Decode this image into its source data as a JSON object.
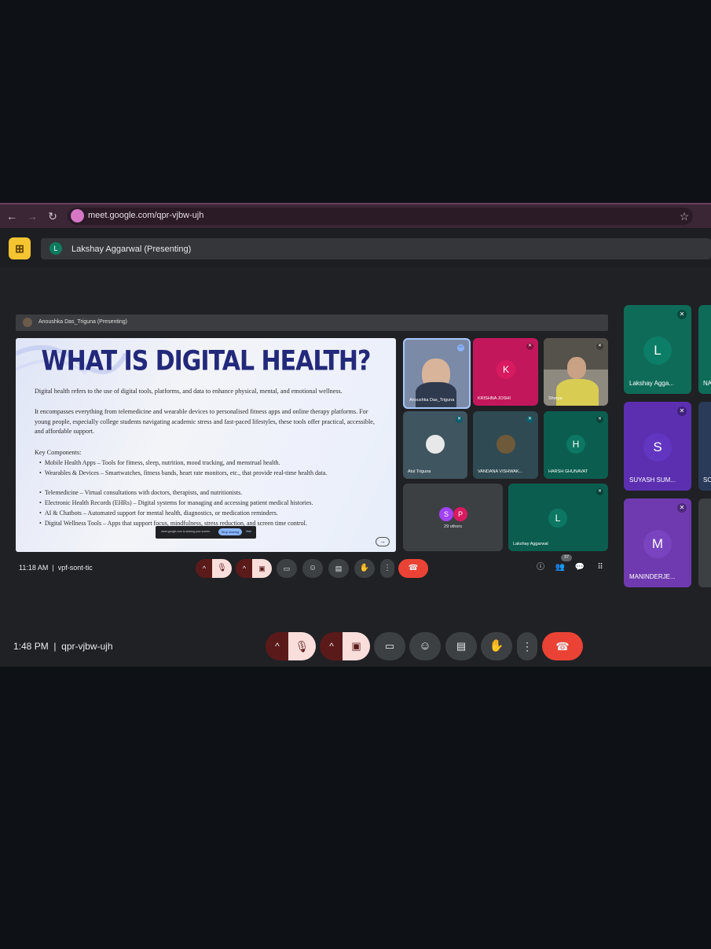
{
  "browser": {
    "back_icon": "←",
    "forward_icon": "→",
    "reload_icon": "↻",
    "url": "meet.google.com/qpr-vjbw-ujh",
    "star_icon": "☆"
  },
  "outer_meet": {
    "presenter_initial": "L",
    "presenting_label": "Lakshay Aggarwal (Presenting)",
    "time": "1:48 PM",
    "meeting_code": "qpr-vjbw-ujh",
    "right_tiles": [
      {
        "initial": "L",
        "name": "Lakshay Agga...",
        "color": "#0e6b58"
      },
      {
        "initial": "S",
        "name": "SUYASH SUM...",
        "color": "#5b2fb0"
      },
      {
        "initial": "M",
        "name": "MANINDERJE...",
        "color": "#6f3aaf"
      }
    ],
    "right_edge_labels": [
      "NA",
      "SO"
    ]
  },
  "inner_meet": {
    "presenting_label": "Anoushka Das_Triguna (Presenting)",
    "time": "11:18 AM",
    "meeting_code": "vpf-sont-tic",
    "participants_badge": "37",
    "share_toast": {
      "text": "meet.google.com is sharing your screen.",
      "stop_label": "Stop sharing",
      "hide_label": "Hide"
    },
    "tiles": [
      {
        "name": "Anoushka Das_Triguna",
        "type": "video"
      },
      {
        "name": "KRISHNA JOSHI",
        "initial": "K",
        "color": "#c2185b"
      },
      {
        "name": "Shreya",
        "type": "video"
      },
      {
        "name": "Atul Triguna",
        "type": "photo"
      },
      {
        "name": "VANDANA VISHWAK...",
        "type": "photo"
      },
      {
        "name": "HARSH GHUNAVAT",
        "initial": "H",
        "color": "#0b5e4f"
      },
      {
        "others_count": "29 others",
        "initials": [
          "S",
          "P"
        ]
      },
      {
        "name": "Lakshay Aggarwal",
        "initial": "L",
        "color": "#0e6b58"
      }
    ]
  },
  "slide": {
    "title": "WHAT IS DIGITAL HEALTH?",
    "para1": "Digital health refers to the use of digital tools, platforms, and data to enhance physical, mental, and emotional wellness.",
    "para2": "It encompasses everything from telemedicine and wearable devices to personalised fitness apps and online therapy platforms. For young people, especially college students navigating academic stress and fast-paced lifestyles, these tools offer practical, accessible, and affordable support.",
    "key_heading": "Key Components:",
    "bullets": [
      "Mobile Health Apps – Tools for fitness, sleep, nutrition, mood tracking, and menstrual health.",
      "Wearables & Devices – Smartwatches, fitness bands, heart rate monitors, etc., that provide real-time health data.",
      "Telemedicine – Virtual consultations with doctors, therapists, and nutritionists.",
      "Electronic Health Records (EHRs) – Digital systems for managing and accessing patient medical histories.",
      "AI & Chatbots – Automated support for mental health, diagnostics, or medication reminders.",
      "Digital Wellness Tools – Apps that support focus, mindfulness, stress reduction, and screen time control."
    ]
  },
  "colors": {
    "hangup": "#ea4335",
    "meet_bg": "#202124",
    "slide_title": "#23297a"
  }
}
